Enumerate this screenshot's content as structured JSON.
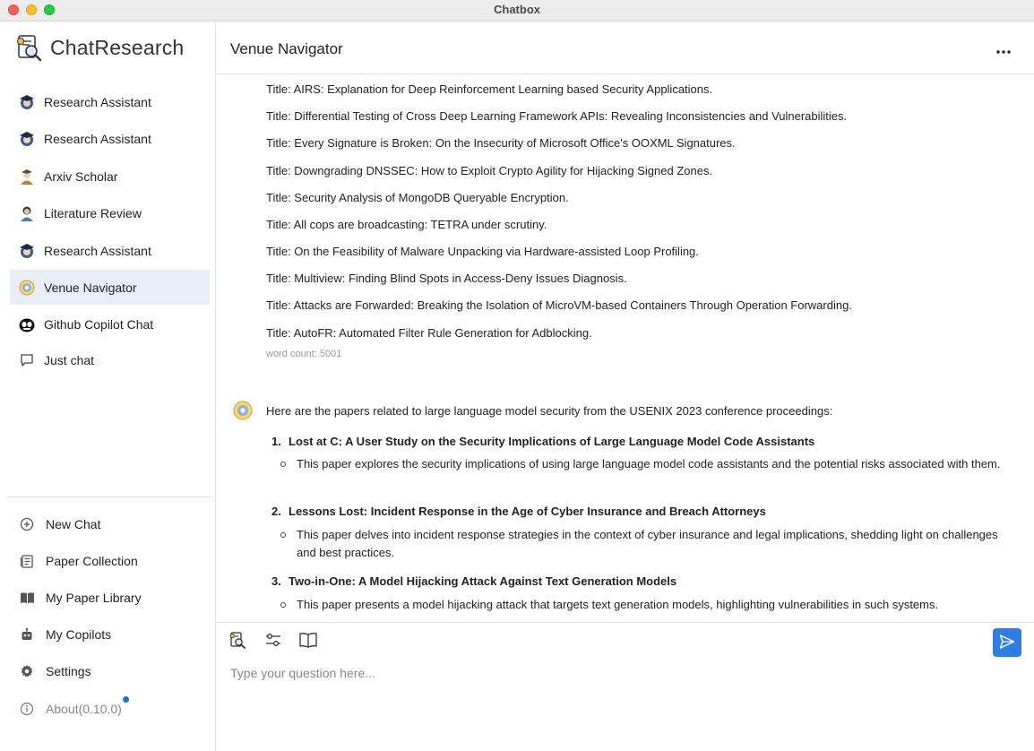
{
  "window": {
    "title": "Chatbox"
  },
  "sidebar": {
    "brand": "ChatResearch",
    "items": [
      {
        "label": "Research Assistant",
        "icon": "research-assistant-avatar-icon"
      },
      {
        "label": "Research Assistant",
        "icon": "research-assistant-avatar-icon"
      },
      {
        "label": "Arxiv Scholar",
        "icon": "arxiv-scholar-avatar-icon"
      },
      {
        "label": "Literature Review",
        "icon": "literature-review-avatar-icon"
      },
      {
        "label": "Research Assistant",
        "icon": "research-assistant-avatar-icon"
      },
      {
        "label": "Venue Navigator",
        "icon": "venue-navigator-avatar-icon",
        "active": true
      },
      {
        "label": "Github Copilot Chat",
        "icon": "github-copilot-avatar-icon"
      },
      {
        "label": "Just chat",
        "icon": "chat-bubble-icon"
      }
    ],
    "bottom": {
      "new_chat": "New Chat",
      "paper_collection": "Paper Collection",
      "my_paper_library": "My Paper Library",
      "my_copilots": "My Copilots",
      "settings": "Settings",
      "about": "About(0.10.0)"
    }
  },
  "header": {
    "title": "Venue Navigator"
  },
  "conversation": {
    "titles": [
      "Title: AIRS: Explanation for Deep Reinforcement Learning based Security Applications.",
      "Title: Differential Testing of Cross Deep Learning Framework APIs: Revealing Inconsistencies and Vulnerabilities.",
      "Title: Every Signature is Broken: On the Insecurity of Microsoft Office's OOXML Signatures.",
      "Title: Downgrading DNSSEC: How to Exploit Crypto Agility for Hijacking Signed Zones.",
      "Title: Security Analysis of MongoDB Queryable Encryption.",
      "Title: All cops are broadcasting: TETRA under scrutiny.",
      "Title: On the Feasibility of Malware Unpacking via Hardware-assisted Loop Profiling.",
      "Title: Multiview: Finding Blind Spots in Access-Deny Issues Diagnosis.",
      "Title: Attacks are Forwarded: Breaking the Isolation of MicroVM-based Containers Through Operation Forwarding.",
      "Title: AutoFR: Automated Filter Rule Generation for Adblocking."
    ],
    "word_count": "word count: 5001",
    "reply_intro": "Here are the papers related to large language model security from the USENIX 2023 conference proceedings:",
    "papers": [
      {
        "num": "1.",
        "title": "Lost at C: A User Study on the Security Implications of Large Language Model Code Assistants",
        "desc": "This paper explores the security implications of using large language model code assistants and the potential risks associated with them."
      },
      {
        "num": "2.",
        "title": "Lessons Lost: Incident Response in the Age of Cyber Insurance and Breach Attorneys",
        "desc": "This paper delves into incident response strategies in the context of cyber insurance and legal implications, shedding light on challenges and best practices."
      },
      {
        "num": "3.",
        "title": "Two-in-One: A Model Hijacking Attack Against Text Generation Models",
        "desc": "This paper presents a model hijacking attack that targets text generation models, highlighting vulnerabilities in such systems."
      }
    ]
  },
  "composer": {
    "placeholder": "Type your question here...",
    "value": ""
  },
  "colors": {
    "accent": "#2f7de1",
    "active_bg": "#e9eef6",
    "badge_dot": "#1e6fd9"
  }
}
